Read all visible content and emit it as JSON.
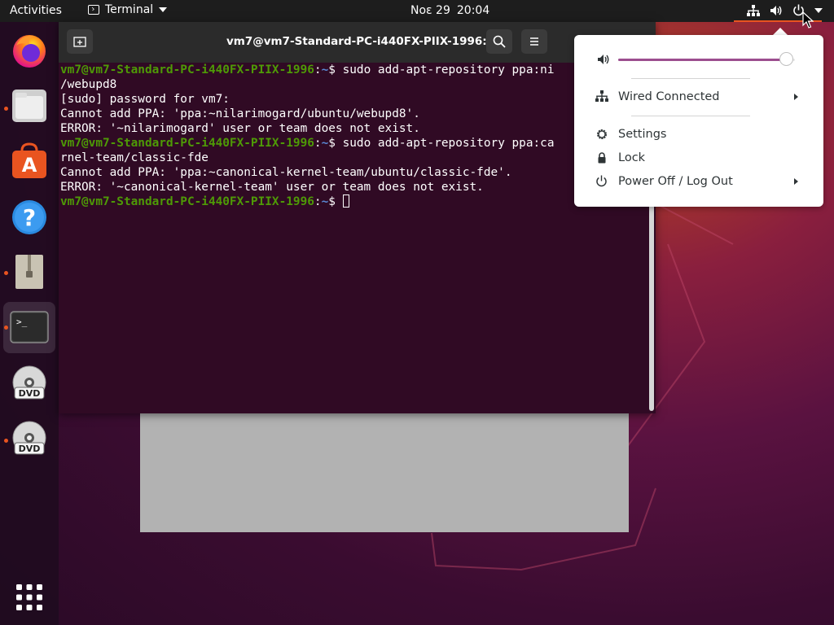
{
  "topbar": {
    "activities_label": "Activities",
    "app_name": "Terminal",
    "date": "Noε 29",
    "time": "20:04"
  },
  "dock": {
    "items": [
      {
        "name": "firefox",
        "running": false
      },
      {
        "name": "files",
        "running": true
      },
      {
        "name": "software",
        "running": false
      },
      {
        "name": "help",
        "running": false
      },
      {
        "name": "archive",
        "running": true
      },
      {
        "name": "terminal",
        "running": true,
        "active": true
      },
      {
        "name": "dvd-1",
        "running": false,
        "label": "DVD"
      },
      {
        "name": "dvd-2",
        "running": true,
        "label": "DVD"
      }
    ]
  },
  "terminal": {
    "title": "vm7@vm7-Standard-PC-i440FX-PIIX-1996: ~",
    "prompt_user": "vm7@vm7-Standard-PC-i440FX-PIIX-1996",
    "prompt_path": "~",
    "lines": [
      {
        "type": "prompt",
        "cmd": " sudo add-apt-repository ppa:ni"
      },
      {
        "type": "out",
        "text": "/webupd8"
      },
      {
        "type": "out",
        "text": "[sudo] password for vm7:"
      },
      {
        "type": "out",
        "text": "Cannot add PPA: 'ppa:~nilarimogard/ubuntu/webupd8'."
      },
      {
        "type": "out",
        "text": "ERROR: '~nilarimogard' user or team does not exist."
      },
      {
        "type": "prompt",
        "cmd": " sudo add-apt-repository ppa:ca"
      },
      {
        "type": "out",
        "text": "rnel-team/classic-fde"
      },
      {
        "type": "out",
        "text": "Cannot add PPA: 'ppa:~canonical-kernel-team/ubuntu/classic-fde'."
      },
      {
        "type": "out",
        "text": "ERROR: '~canonical-kernel-team' user or team does not exist."
      },
      {
        "type": "prompt",
        "cmd": " ",
        "cursor": true
      }
    ]
  },
  "system_menu": {
    "volume": 0.95,
    "network_label": "Wired Connected",
    "settings_label": "Settings",
    "lock_label": "Lock",
    "power_label": "Power Off / Log Out"
  },
  "colors": {
    "accent": "#e95420",
    "terminal_bg": "#300a24",
    "prompt_user": "#4e9a06",
    "prompt_path": "#5a8ad6",
    "slider": "#9c4e8f"
  }
}
